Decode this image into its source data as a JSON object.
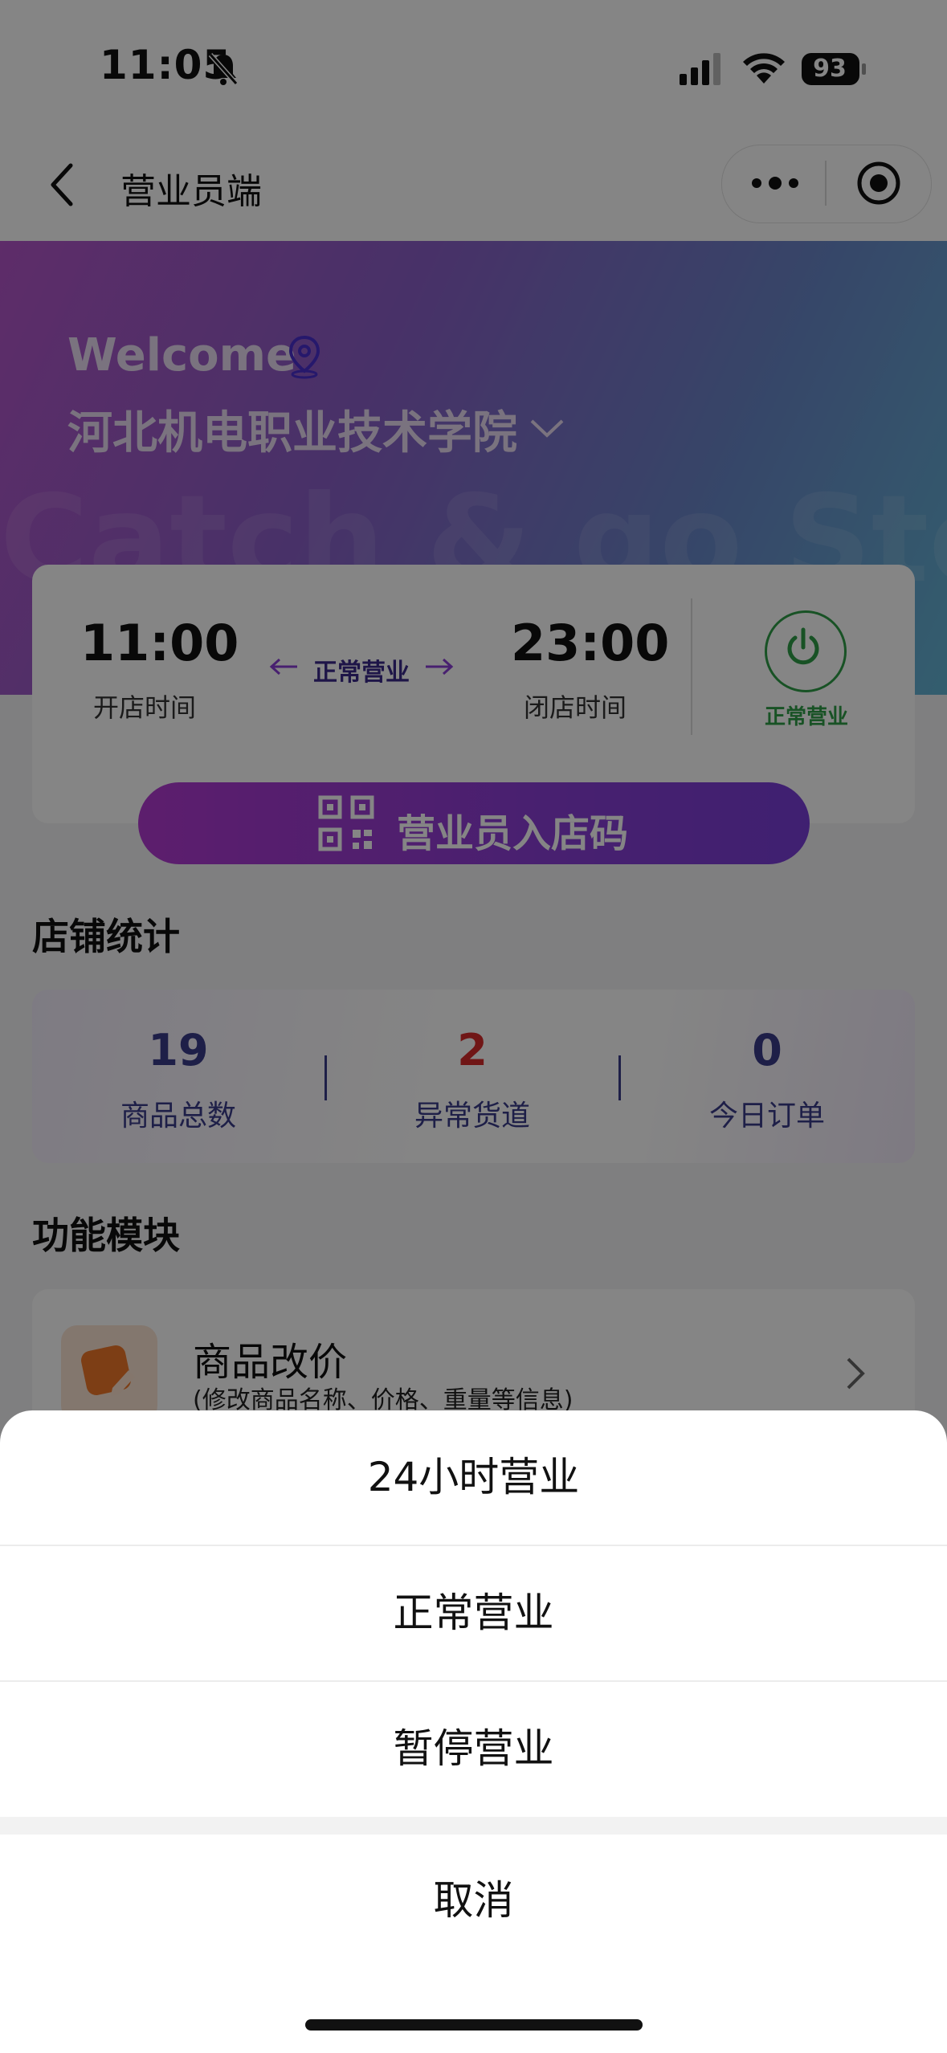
{
  "status_bar": {
    "time": "11:05",
    "battery": "93",
    "icons": [
      "bell-slash-icon",
      "signal-icon",
      "wifi-icon",
      "battery-icon"
    ]
  },
  "nav": {
    "title": "营业员端",
    "back_icon": "chevron-left-icon",
    "more_icon": "more-dots-icon",
    "close_icon": "target-icon"
  },
  "hero": {
    "welcome": "Welcome",
    "location_icon": "location-pin-icon",
    "school": "河北机电职业技术学院",
    "watermark": "Catch & go Store"
  },
  "hours": {
    "open_time": "11:00",
    "open_label": "开店时间",
    "status": "正常营业",
    "close_time": "23:00",
    "close_label": "闭店时间",
    "power_label": "正常营业",
    "qr_button": "营业员入店码"
  },
  "stats": {
    "title": "店铺统计",
    "items": [
      {
        "value": "19",
        "label": "商品总数",
        "color": "#3b3d8a"
      },
      {
        "value": "2",
        "label": "异常货道",
        "color": "#d62b2b"
      },
      {
        "value": "0",
        "label": "今日订单",
        "color": "#3b3d8a"
      }
    ]
  },
  "modules": {
    "title": "功能模块",
    "items": [
      {
        "title": "商品改价",
        "subtitle": "(修改商品名称、价格、重量等信息)"
      }
    ]
  },
  "action_sheet": {
    "options": [
      "24小时营业",
      "正常营业",
      "暂停营业"
    ],
    "cancel": "取消"
  },
  "colors": {
    "accent": "#8b3ed6",
    "success": "#2e9e47",
    "danger": "#d62b2b"
  }
}
